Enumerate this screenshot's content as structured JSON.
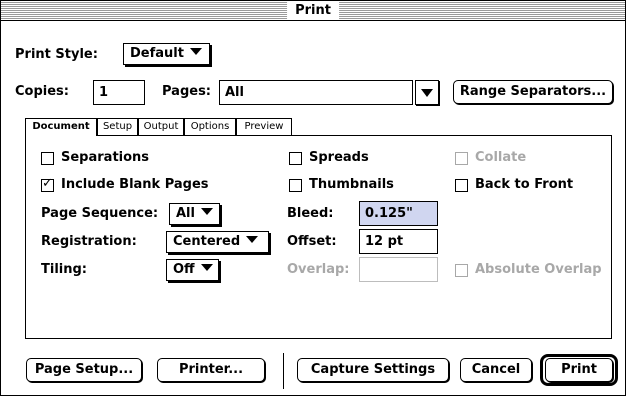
{
  "window": {
    "title": "Print"
  },
  "print_style": {
    "label": "Print Style:",
    "value": "Default"
  },
  "copies": {
    "label": "Copies:",
    "value": "1"
  },
  "pages": {
    "label": "Pages:",
    "value": "All"
  },
  "range_separators_button": "Range Separators...",
  "tabs": [
    "Document",
    "Setup",
    "Output",
    "Options",
    "Preview"
  ],
  "document_tab": {
    "separations": {
      "label": "Separations",
      "checked": false
    },
    "spreads": {
      "label": "Spreads",
      "checked": false
    },
    "collate": {
      "label": "Collate",
      "checked": false,
      "enabled": false
    },
    "include_blank_pages": {
      "label": "Include Blank Pages",
      "checked": true
    },
    "thumbnails": {
      "label": "Thumbnails",
      "checked": false
    },
    "back_to_front": {
      "label": "Back to Front",
      "checked": false
    },
    "page_sequence": {
      "label": "Page Sequence:",
      "value": "All"
    },
    "bleed": {
      "label": "Bleed:",
      "value": "0.125\""
    },
    "registration": {
      "label": "Registration:",
      "value": "Centered"
    },
    "offset": {
      "label": "Offset:",
      "value": "12 pt"
    },
    "tiling": {
      "label": "Tiling:",
      "value": "Off"
    },
    "overlap": {
      "label": "Overlap:",
      "value": "",
      "enabled": false
    },
    "absolute_overlap": {
      "label": "Absolute Overlap",
      "checked": false,
      "enabled": false
    }
  },
  "buttons": {
    "page_setup": "Page Setup...",
    "printer": "Printer...",
    "capture_settings": "Capture Settings",
    "cancel": "Cancel",
    "print": "Print"
  },
  "check_glyph": "☑"
}
